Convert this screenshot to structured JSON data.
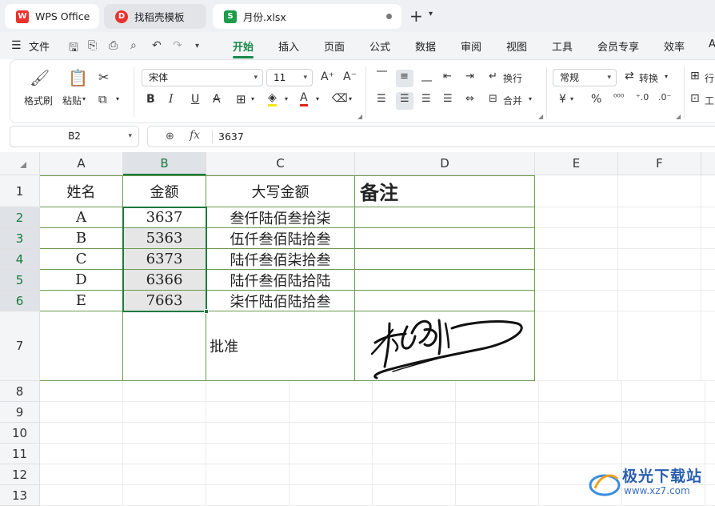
{
  "tabs": [
    {
      "label": "WPS Office",
      "icon": "wps-logo-icon"
    },
    {
      "label": "找稻壳模板",
      "icon": "docer-icon"
    },
    {
      "label": "月份.xlsx",
      "icon": "spreadsheet-icon"
    }
  ],
  "menu": {
    "file_label": "文件",
    "tabs": [
      "开始",
      "插入",
      "页面",
      "公式",
      "数据",
      "审阅",
      "视图",
      "工具",
      "会员专享",
      "效率",
      "A"
    ]
  },
  "ribbon": {
    "format_painter": "格式刷",
    "paste": "粘贴",
    "font_name": "宋体",
    "font_size": "11",
    "wrap_text": "换行",
    "merge": "合并",
    "number_format": "常规",
    "convert": "转换",
    "rows_cols": "行",
    "worksheet": "工",
    "accent_color": "#1a8a4a"
  },
  "formula_bar": {
    "name_box": "B2",
    "fx_label": "fx",
    "value": "3637"
  },
  "sheet": {
    "columns": [
      "A",
      "B",
      "C",
      "D",
      "E",
      "F"
    ],
    "rows": [
      "1",
      "2",
      "3",
      "4",
      "5",
      "6",
      "7",
      "8",
      "9",
      "10",
      "11",
      "12",
      "13"
    ],
    "header_row": [
      "姓名",
      "金额",
      "大写金额",
      "备注"
    ],
    "data_rows": [
      [
        "A",
        "3637",
        "叁仟陆佰叁拾柒",
        ""
      ],
      [
        "B",
        "5363",
        "伍仟叁佰陆拾叁",
        ""
      ],
      [
        "C",
        "6373",
        "陆仟叁佰柒拾叁",
        ""
      ],
      [
        "D",
        "6366",
        "陆仟叁佰陆拾陆",
        ""
      ],
      [
        "E",
        "7663",
        "柒仟陆佰陆拾叁",
        ""
      ]
    ],
    "approve_label": "批准",
    "selected_range": "B2:B6"
  },
  "watermark": {
    "text": "极光下载站",
    "url": "www.xz7.com"
  }
}
